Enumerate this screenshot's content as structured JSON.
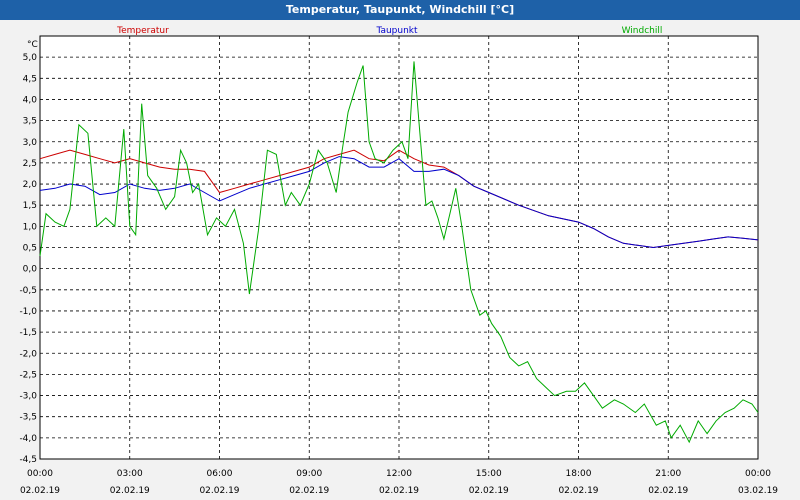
{
  "window": {
    "title": "Temperatur, Taupunkt, Windchill [°C]"
  },
  "chart_data": {
    "type": "line",
    "title": "Temperatur, Taupunkt, Windchill [°C]",
    "ylabel": "°C",
    "ylim": [
      -4.5,
      5.5
    ],
    "yticks": [
      5.0,
      4.5,
      4.0,
      3.5,
      3.0,
      2.5,
      2.0,
      1.5,
      1.0,
      0.5,
      0.0,
      -0.5,
      -1.0,
      -1.5,
      -2.0,
      -2.5,
      -3.0,
      -3.5,
      -4.0,
      -4.5
    ],
    "ytick_labels": [
      "5,0",
      "4,5",
      "4,0",
      "3,5",
      "3,0",
      "2,5",
      "2,0",
      "1,5",
      "1,0",
      "0,5",
      "0,0",
      "-0,5",
      "-1,0",
      "-1,5",
      "-2,0",
      "-2,5",
      "-3,0",
      "-3,5",
      "-4,0",
      "-4,5"
    ],
    "xlim": [
      0,
      24
    ],
    "x_ticks": [
      {
        "x": 0,
        "time": "00:00",
        "date": "02.02.19"
      },
      {
        "x": 3,
        "time": "03:00",
        "date": "02.02.19"
      },
      {
        "x": 6,
        "time": "06:00",
        "date": "02.02.19"
      },
      {
        "x": 9,
        "time": "09:00",
        "date": "02.02.19"
      },
      {
        "x": 12,
        "time": "12:00",
        "date": "02.02.19"
      },
      {
        "x": 15,
        "time": "15:00",
        "date": "02.02.19"
      },
      {
        "x": 18,
        "time": "18:00",
        "date": "02.02.19"
      },
      {
        "x": 21,
        "time": "21:00",
        "date": "02.02.19"
      },
      {
        "x": 24,
        "time": "00:00",
        "date": "03.02.19"
      }
    ],
    "grid": true,
    "series": [
      {
        "name": "Temperatur",
        "color": "#cc0000",
        "points": [
          [
            0,
            2.6
          ],
          [
            0.5,
            2.7
          ],
          [
            1,
            2.8
          ],
          [
            1.5,
            2.7
          ],
          [
            2,
            2.6
          ],
          [
            2.5,
            2.5
          ],
          [
            3,
            2.6
          ],
          [
            3.5,
            2.5
          ],
          [
            4,
            2.4
          ],
          [
            4.5,
            2.35
          ],
          [
            5,
            2.35
          ],
          [
            5.5,
            2.3
          ],
          [
            6,
            1.8
          ],
          [
            6.5,
            1.9
          ],
          [
            7,
            2.0
          ],
          [
            7.5,
            2.1
          ],
          [
            8,
            2.2
          ],
          [
            8.5,
            2.3
          ],
          [
            9,
            2.4
          ],
          [
            9.5,
            2.6
          ],
          [
            10,
            2.7
          ],
          [
            10.5,
            2.8
          ],
          [
            11,
            2.6
          ],
          [
            11.5,
            2.55
          ],
          [
            12,
            2.8
          ],
          [
            12.5,
            2.6
          ],
          [
            13,
            2.45
          ],
          [
            13.5,
            2.4
          ],
          [
            14,
            2.2
          ],
          [
            14.5,
            1.95
          ],
          [
            15,
            1.8
          ],
          [
            16,
            1.5
          ],
          [
            17,
            1.25
          ],
          [
            18,
            1.1
          ],
          [
            18.5,
            0.95
          ],
          [
            19,
            0.75
          ],
          [
            19.5,
            0.6
          ],
          [
            20,
            0.55
          ],
          [
            20.5,
            0.5
          ],
          [
            21,
            0.55
          ],
          [
            22,
            0.65
          ],
          [
            22.5,
            0.7
          ],
          [
            23,
            0.75
          ],
          [
            23.5,
            0.72
          ],
          [
            24,
            0.68
          ]
        ]
      },
      {
        "name": "Taupunkt",
        "color": "#0000cc",
        "points": [
          [
            0,
            1.85
          ],
          [
            0.5,
            1.9
          ],
          [
            1,
            2.0
          ],
          [
            1.5,
            1.95
          ],
          [
            2,
            1.75
          ],
          [
            2.5,
            1.8
          ],
          [
            3,
            2.0
          ],
          [
            3.5,
            1.9
          ],
          [
            4,
            1.85
          ],
          [
            4.5,
            1.9
          ],
          [
            5,
            2.0
          ],
          [
            5.5,
            1.8
          ],
          [
            6,
            1.6
          ],
          [
            6.5,
            1.75
          ],
          [
            7,
            1.9
          ],
          [
            7.5,
            2.0
          ],
          [
            8,
            2.1
          ],
          [
            8.5,
            2.2
          ],
          [
            9,
            2.3
          ],
          [
            9.5,
            2.5
          ],
          [
            10,
            2.65
          ],
          [
            10.5,
            2.6
          ],
          [
            11,
            2.4
          ],
          [
            11.5,
            2.4
          ],
          [
            12,
            2.6
          ],
          [
            12.5,
            2.3
          ],
          [
            13,
            2.3
          ],
          [
            13.5,
            2.35
          ],
          [
            14,
            2.2
          ],
          [
            14.5,
            1.95
          ],
          [
            15,
            1.8
          ],
          [
            16,
            1.5
          ],
          [
            17,
            1.25
          ],
          [
            18,
            1.1
          ],
          [
            18.5,
            0.95
          ],
          [
            19,
            0.75
          ],
          [
            19.5,
            0.6
          ],
          [
            20,
            0.55
          ],
          [
            20.5,
            0.5
          ],
          [
            21,
            0.55
          ],
          [
            22,
            0.65
          ],
          [
            22.5,
            0.7
          ],
          [
            23,
            0.75
          ],
          [
            23.5,
            0.72
          ],
          [
            24,
            0.68
          ]
        ]
      },
      {
        "name": "Windchill",
        "color": "#00aa00",
        "points": [
          [
            0,
            0.3
          ],
          [
            0.2,
            1.3
          ],
          [
            0.5,
            1.1
          ],
          [
            0.8,
            1.0
          ],
          [
            1.0,
            1.4
          ],
          [
            1.3,
            3.4
          ],
          [
            1.6,
            3.2
          ],
          [
            1.9,
            1.0
          ],
          [
            2.2,
            1.2
          ],
          [
            2.5,
            1.0
          ],
          [
            2.8,
            3.3
          ],
          [
            3.0,
            1.0
          ],
          [
            3.2,
            0.8
          ],
          [
            3.4,
            3.9
          ],
          [
            3.6,
            2.2
          ],
          [
            3.9,
            1.9
          ],
          [
            4.2,
            1.4
          ],
          [
            4.5,
            1.7
          ],
          [
            4.7,
            2.8
          ],
          [
            4.9,
            2.5
          ],
          [
            5.1,
            1.8
          ],
          [
            5.3,
            2.0
          ],
          [
            5.6,
            0.8
          ],
          [
            5.9,
            1.2
          ],
          [
            6.2,
            1.0
          ],
          [
            6.5,
            1.4
          ],
          [
            6.8,
            0.6
          ],
          [
            7.0,
            -0.6
          ],
          [
            7.3,
            0.9
          ],
          [
            7.6,
            2.8
          ],
          [
            7.9,
            2.7
          ],
          [
            8.2,
            1.5
          ],
          [
            8.4,
            1.8
          ],
          [
            8.7,
            1.5
          ],
          [
            9.0,
            2.0
          ],
          [
            9.3,
            2.8
          ],
          [
            9.6,
            2.5
          ],
          [
            9.9,
            1.8
          ],
          [
            10.1,
            2.8
          ],
          [
            10.3,
            3.7
          ],
          [
            10.6,
            4.4
          ],
          [
            10.8,
            4.8
          ],
          [
            11.0,
            3.0
          ],
          [
            11.2,
            2.6
          ],
          [
            11.5,
            2.5
          ],
          [
            11.8,
            2.8
          ],
          [
            12.1,
            3.0
          ],
          [
            12.3,
            2.6
          ],
          [
            12.5,
            4.9
          ],
          [
            12.7,
            3.2
          ],
          [
            12.9,
            1.5
          ],
          [
            13.1,
            1.6
          ],
          [
            13.3,
            1.2
          ],
          [
            13.5,
            0.7
          ],
          [
            13.7,
            1.3
          ],
          [
            13.9,
            1.9
          ],
          [
            14.1,
            1.0
          ],
          [
            14.4,
            -0.5
          ],
          [
            14.7,
            -1.1
          ],
          [
            14.9,
            -1.0
          ],
          [
            15.1,
            -1.3
          ],
          [
            15.4,
            -1.6
          ],
          [
            15.7,
            -2.1
          ],
          [
            16.0,
            -2.3
          ],
          [
            16.3,
            -2.2
          ],
          [
            16.6,
            -2.6
          ],
          [
            16.9,
            -2.8
          ],
          [
            17.2,
            -3.0
          ],
          [
            17.6,
            -2.9
          ],
          [
            17.9,
            -2.9
          ],
          [
            18.2,
            -2.7
          ],
          [
            18.5,
            -3.0
          ],
          [
            18.8,
            -3.3
          ],
          [
            19.2,
            -3.1
          ],
          [
            19.5,
            -3.2
          ],
          [
            19.9,
            -3.4
          ],
          [
            20.2,
            -3.2
          ],
          [
            20.6,
            -3.7
          ],
          [
            20.9,
            -3.6
          ],
          [
            21.1,
            -4.0
          ],
          [
            21.4,
            -3.7
          ],
          [
            21.7,
            -4.1
          ],
          [
            22.0,
            -3.6
          ],
          [
            22.3,
            -3.9
          ],
          [
            22.6,
            -3.6
          ],
          [
            22.9,
            -3.4
          ],
          [
            23.2,
            -3.3
          ],
          [
            23.5,
            -3.1
          ],
          [
            23.8,
            -3.2
          ],
          [
            24,
            -3.4
          ]
        ]
      }
    ]
  }
}
